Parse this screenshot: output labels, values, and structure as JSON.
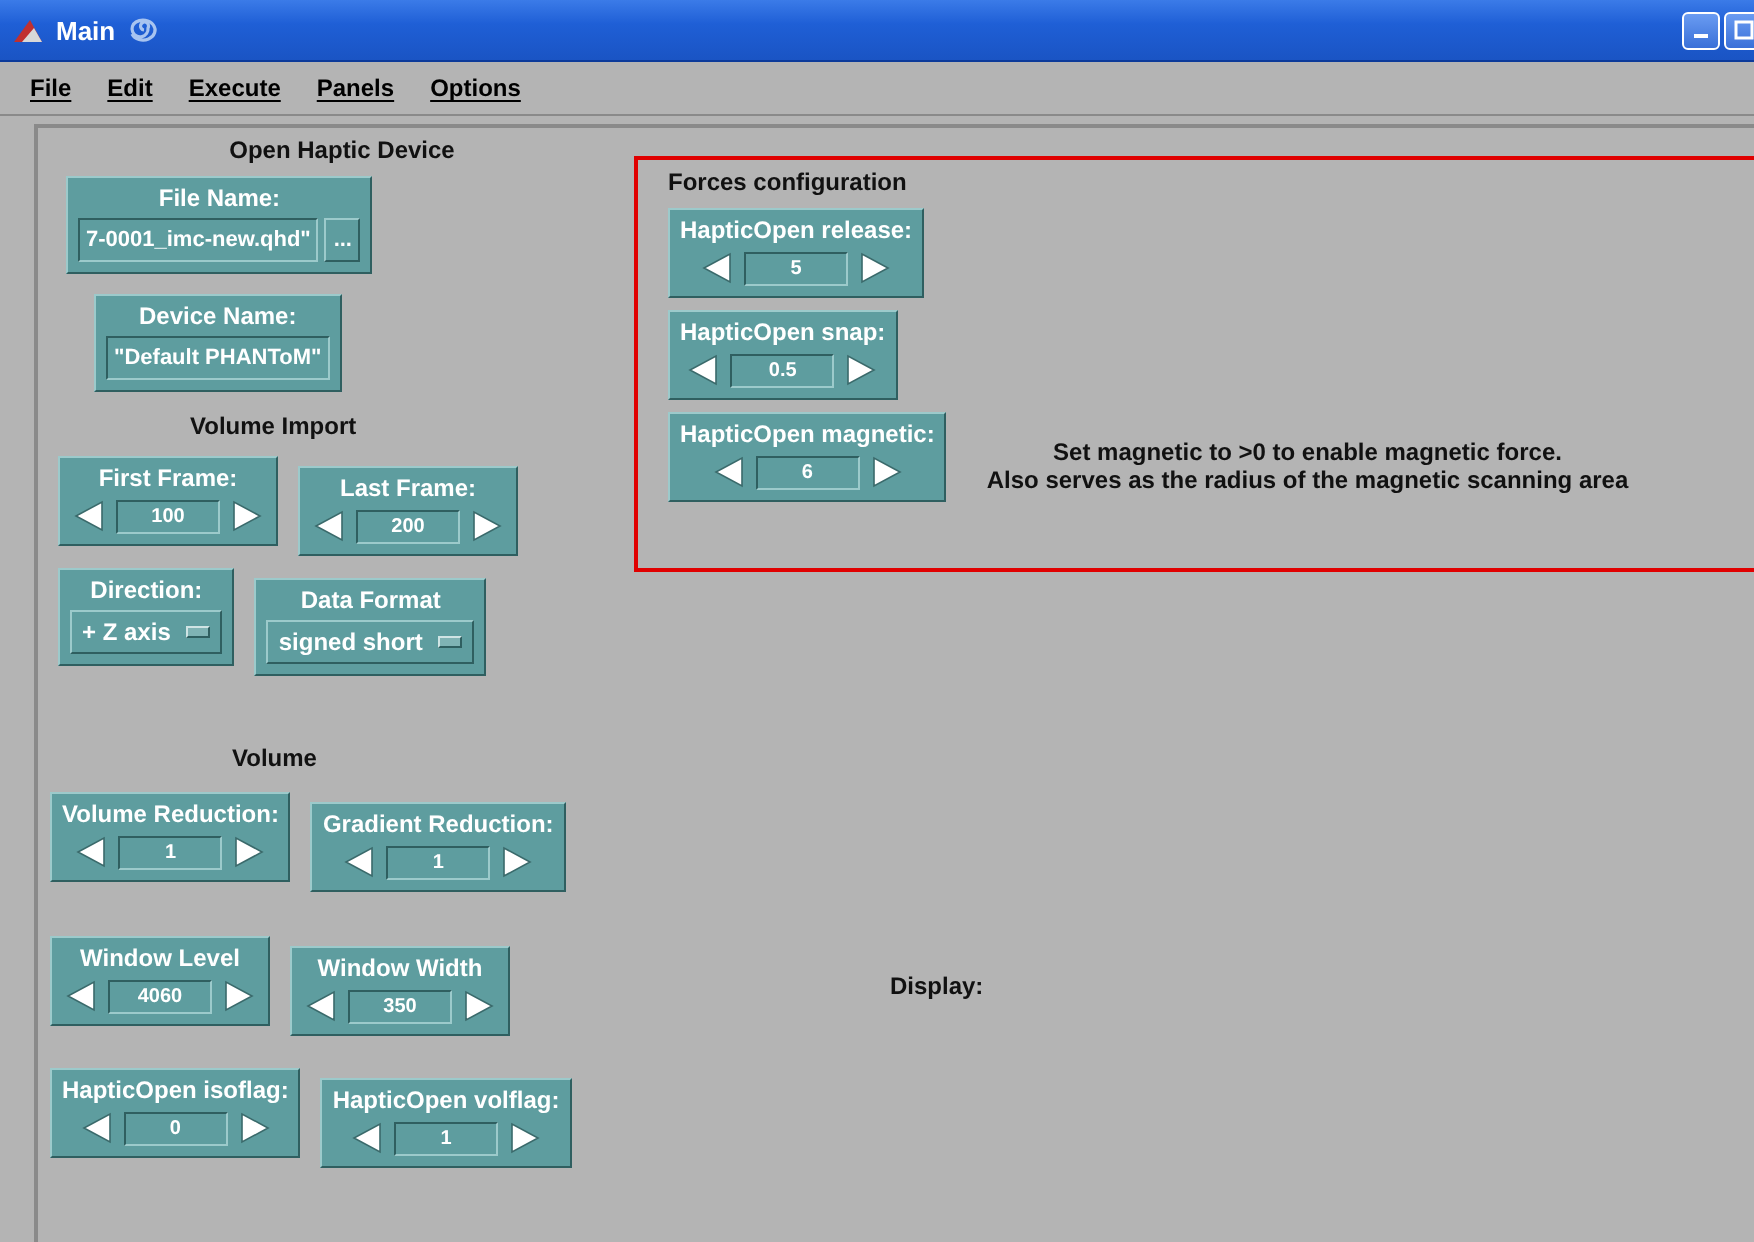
{
  "window": {
    "title": "Main"
  },
  "menu": [
    "File",
    "Edit",
    "Execute",
    "Panels",
    "Options"
  ],
  "open_haptic_device": {
    "heading": "Open Haptic Device",
    "file_name": {
      "label": "File Name:",
      "value": "7-0001_imc-new.qhd\"",
      "browse": "..."
    },
    "device_name": {
      "label": "Device Name:",
      "value": "\"Default PHANToM\""
    }
  },
  "volume_import": {
    "heading": "Volume Import",
    "rows": [
      [
        {
          "kind": "spinner",
          "label": "First Frame:",
          "value": "100"
        },
        {
          "kind": "spinner",
          "label": "Last Frame:",
          "value": "200"
        }
      ],
      [
        {
          "kind": "dropdown",
          "label": "Direction:",
          "value": "+ Z axis"
        },
        {
          "kind": "dropdown",
          "label": "Data Format",
          "value": "signed short"
        }
      ]
    ]
  },
  "volume": {
    "heading": "Volume",
    "rows": [
      [
        {
          "kind": "spinner",
          "label": "Volume Reduction:",
          "value": "1"
        },
        {
          "kind": "spinner",
          "label": "Gradient Reduction:",
          "value": "1"
        }
      ],
      [
        {
          "kind": "spinner",
          "label": "Window Level",
          "value": "4060"
        },
        {
          "kind": "spinner",
          "label": "Window Width",
          "value": "350"
        }
      ],
      [
        {
          "kind": "spinner",
          "label": "HapticOpen isoflag:",
          "value": "0"
        },
        {
          "kind": "spinner",
          "label": "HapticOpen volflag:",
          "value": "1"
        }
      ]
    ]
  },
  "forces_configuration": {
    "heading": "Forces configuration",
    "controls": [
      {
        "kind": "spinner",
        "label": "HapticOpen release:",
        "value": "5"
      },
      {
        "kind": "spinner",
        "label": "HapticOpen snap:",
        "value": "0.5"
      },
      {
        "kind": "spinner",
        "label": "HapticOpen magnetic:",
        "value": "6"
      }
    ],
    "note": [
      "Set magnetic to >0 to enable magnetic force.",
      "Also serves as the radius of the magnetic scanning area"
    ]
  },
  "display": {
    "label": "Display:"
  }
}
